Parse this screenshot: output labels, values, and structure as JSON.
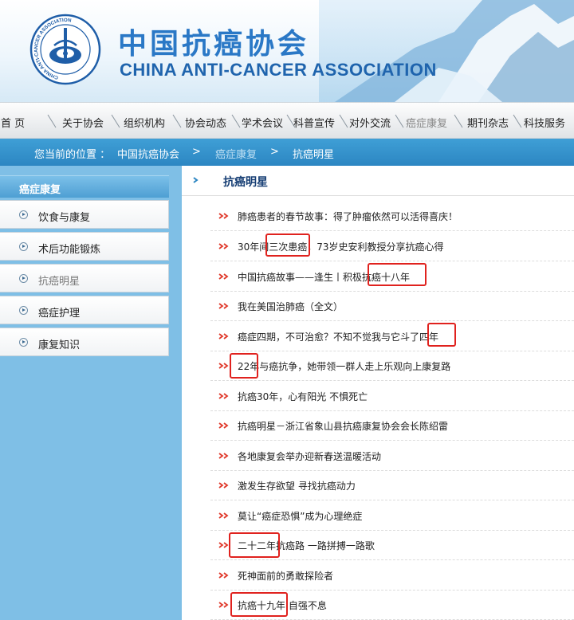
{
  "header": {
    "brand_cn": "中国抗癌协会",
    "brand_en": "CHINA ANTI-CANCER ASSOCIATION",
    "logo_ring_text": "CHINA ANTI-CANCER ASSOCIATION",
    "logo_top_text": "中国抗癌协会"
  },
  "nav": {
    "items": [
      "首 页",
      "关于协会",
      "组织机构",
      "协会动态",
      "学术会议",
      "科普宣传",
      "对外交流",
      "癌症康复",
      "期刊杂志",
      "科技服务"
    ],
    "active": "癌症康复"
  },
  "breadcrumb": {
    "prefix": "您当前的位置 ：",
    "items": [
      "中国抗癌协会",
      "癌症康复",
      "抗癌明星"
    ],
    "separator": ">"
  },
  "sidebar": {
    "title": "癌症康复",
    "items": [
      "饮食与康复",
      "术后功能锻炼",
      "抗癌明星",
      "癌症护理",
      "康复知识"
    ],
    "active": "抗癌明星"
  },
  "content": {
    "title": "抗癌明星",
    "articles": [
      "肺癌患者的春节故事：得了肿瘤依然可以活得喜庆！",
      "30年间三次患癌，73岁史安利教授分享抗癌心得",
      "中国抗癌故事——逢生丨积极抗癌十八年",
      "我在美国治肺癌（全文）",
      "癌症四期，不可治愈？不知不觉我与它斗了四年",
      "22年与癌抗争，她带领一群人走上乐观向上康复路",
      "抗癌30年，心有阳光 不惧死亡",
      "抗癌明星－浙江省象山县抗癌康复协会会长陈绍雷",
      "各地康复会举办迎新春送温暖活动",
      "激发生存欲望 寻找抗癌动力",
      "莫让“癌症恐惧”成为心理绝症",
      "二十二年抗癌路 一路拼搏一路歌",
      "死神面前的勇敢探险者",
      "抗癌十九年 自强不息"
    ]
  },
  "colors": {
    "brand_blue": "#2a78c6",
    "breadcrumb_bar": "#2c86c2",
    "sidebar_bg": "#7fbfe6",
    "bullet_red": "#e0382a",
    "highlight_red": "#e0221e"
  }
}
